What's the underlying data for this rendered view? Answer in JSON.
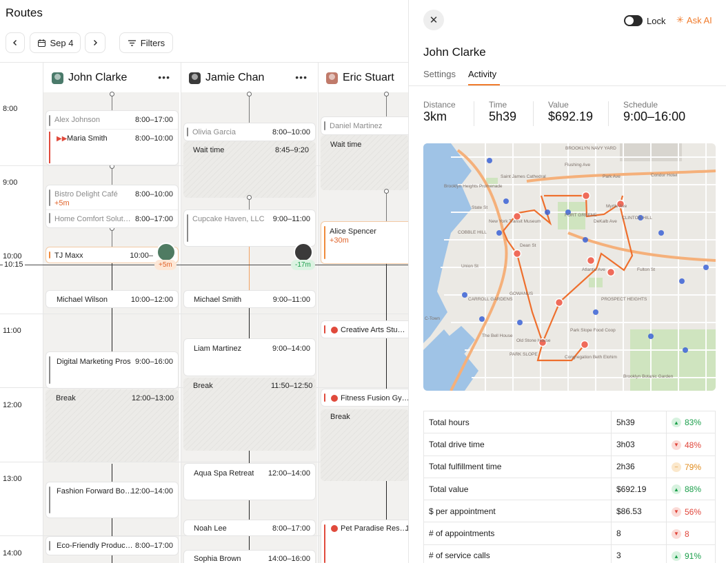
{
  "page_title": "Routes",
  "toolbar": {
    "date": "Sep 4",
    "filters": "Filters"
  },
  "drivers": [
    {
      "name": "John Clarke",
      "avatar_color": "#4a7a6a"
    },
    {
      "name": "Jamie Chan",
      "avatar_color": "#3a3a3a"
    },
    {
      "name": "Eric Stuart",
      "avatar_color": "#c07a6a"
    }
  ],
  "times": [
    "8:00",
    "9:00",
    "10:00",
    "11:00",
    "12:00",
    "13:00",
    "14:00"
  ],
  "now_time": "10:15",
  "col1": [
    {
      "name": "Alex Johnson",
      "time": "8:00–17:00",
      "style": "muted"
    },
    {
      "name": "Maria Smith",
      "time": "8:00–10:00",
      "style": "red"
    },
    {
      "name": "Bistro Delight Café",
      "time": "8:00–10:00",
      "sub": "+5m",
      "style": "muted"
    },
    {
      "name": "Home Comfort Solut…",
      "time": "8:00–17:00",
      "style": "muted"
    },
    {
      "name": "TJ Maxx",
      "time": "10:00–",
      "style": "org"
    },
    {
      "name": "Michael Wilson",
      "time": "10:00–12:00",
      "style": ""
    },
    {
      "name": "Digital Marketing Pros",
      "time": "9:00–16:00",
      "style": ""
    },
    {
      "name": "Fashion Forward Bo…",
      "time": "12:00–14:00",
      "style": ""
    },
    {
      "name": "Eco-Friendly Produc…",
      "time": "8:00–17:00",
      "style": ""
    }
  ],
  "col1_break": {
    "label": "Break",
    "time": "12:00–13:00"
  },
  "col1_delay": "+5m",
  "col2": [
    {
      "name": "Olivia Garcia",
      "time": "8:00–10:00",
      "style": "muted"
    },
    {
      "name": "Cupcake Haven, LLC",
      "time": "9:00–11:00",
      "style": "muted"
    },
    {
      "name": "Michael Smith",
      "time": "9:00–11:00",
      "style": ""
    },
    {
      "name": "Liam Martinez",
      "time": "9:00–14:00",
      "style": ""
    },
    {
      "name": "Aqua Spa Retreat",
      "time": "12:00–14:00",
      "style": ""
    },
    {
      "name": "Noah Lee",
      "time": "8:00–17:00",
      "style": ""
    },
    {
      "name": "Sophia Brown",
      "time": "14:00–16:00",
      "style": ""
    }
  ],
  "col2_wait": {
    "label": "Wait time",
    "time": "8:45–9:20"
  },
  "col2_break": {
    "label": "Break",
    "time": "11:50–12:50"
  },
  "col2_delay": "-17m",
  "col3": [
    {
      "name": "Daniel Martinez",
      "style": "muted"
    },
    {
      "name": "Alice Spencer",
      "sub": "+30m",
      "style": "org"
    },
    {
      "name": "Creative Arts Stu…",
      "style": "red"
    },
    {
      "name": "Fitness Fusion Gy…",
      "style": "red"
    },
    {
      "name": "Pet Paradise Res…",
      "time": "1",
      "style": "red"
    }
  ],
  "col3_wait": "Wait time",
  "col3_break": "Break",
  "panel": {
    "title": "John Clarke",
    "lock": "Lock",
    "ask_ai": "Ask AI",
    "tabs": [
      "Settings",
      "Activity"
    ],
    "active_tab": "Activity",
    "stats": [
      {
        "label": "Distance",
        "value": "3km"
      },
      {
        "label": "Time",
        "value": "5h39"
      },
      {
        "label": "Value",
        "value": "$692.19"
      },
      {
        "label": "Schedule",
        "value": "9:00–16:00"
      }
    ],
    "map_labels": [
      "BROOKLYN NAVY YARD",
      "Flushing Ave",
      "Saint James Cathedral",
      "Park Ave",
      "Condor Hotel",
      "Brooklyn Heights Promenade",
      "State St",
      "Myrtle Ave",
      "New York Transit Museum",
      "FORT GREENE",
      "DeKalb Ave",
      "CLINTON HILL",
      "COBBLE HILL",
      "Dean St",
      "Atlantic Ave",
      "Fulton St",
      "Union St",
      "CARROLL GARDENS",
      "GOWANUS",
      "PROSPECT HEIGHTS",
      "Park Slope Food Coop",
      "The Bell House",
      "Old Stone House",
      "PARK SLOPE",
      "Congregation Beth Elohim",
      "Brooklyn Botanic Garden",
      "C-Town"
    ],
    "summary": [
      {
        "label": "Total hours",
        "value": "5h39",
        "trend": "83%",
        "dir": "up",
        "color": "#1a9e4a"
      },
      {
        "label": "Total drive time",
        "value": "3h03",
        "trend": "48%",
        "dir": "down",
        "color": "#e0453a"
      },
      {
        "label": "Total fulfillment time",
        "value": "2h36",
        "trend": "79%",
        "dir": "flat",
        "color": "#e08a1a"
      },
      {
        "label": "Total value",
        "value": "$692.19",
        "trend": "88%",
        "dir": "up",
        "color": "#1a9e4a"
      },
      {
        "label": "$ per appointment",
        "value": "$86.53",
        "trend": "56%",
        "dir": "down",
        "color": "#e0453a"
      },
      {
        "label": "# of appointments",
        "value": "8",
        "trend": "8",
        "dir": "down",
        "color": "#e0453a"
      },
      {
        "label": "# of service calls",
        "value": "3",
        "trend": "91%",
        "dir": "up",
        "color": "#1a9e4a"
      }
    ]
  }
}
